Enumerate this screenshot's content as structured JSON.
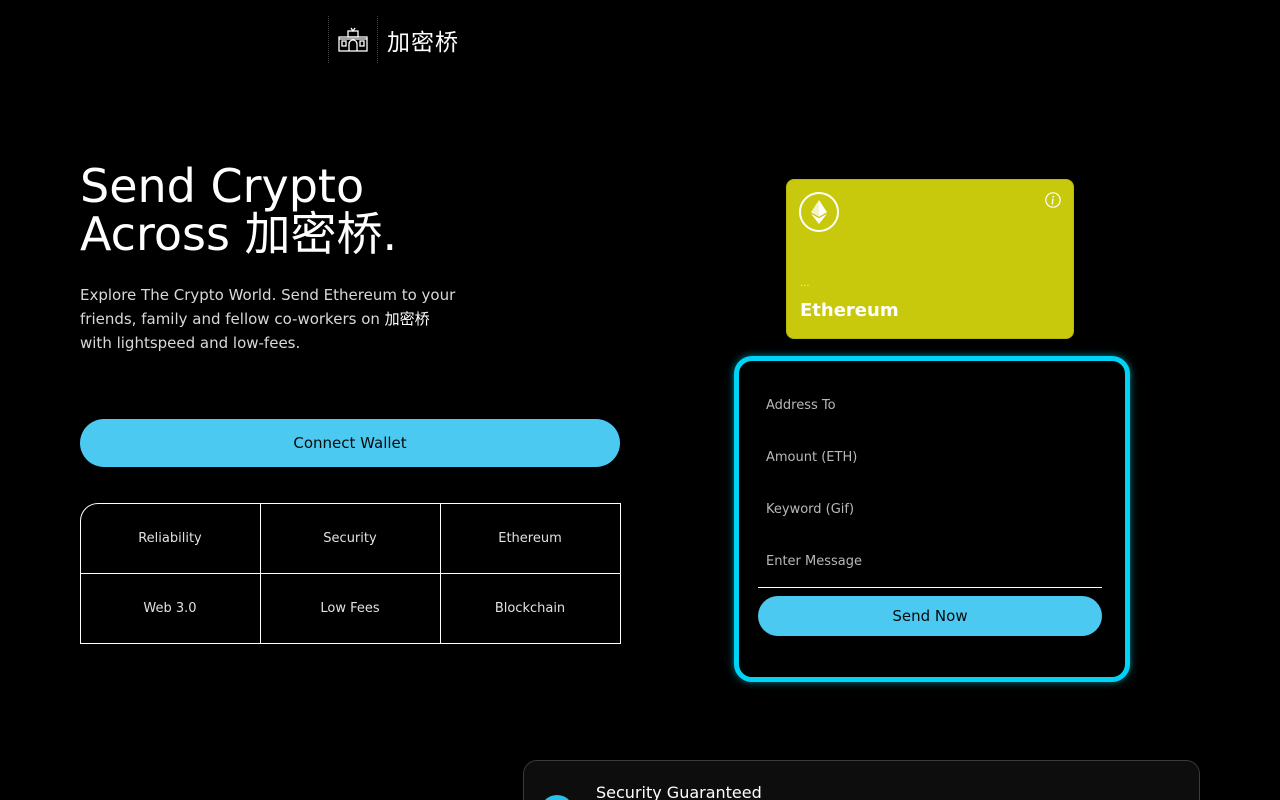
{
  "header": {
    "brand_name": "加密桥",
    "logo_icon": "bridge-gate-icon"
  },
  "hero": {
    "title_line1": "Send Crypto",
    "title_line2": "Across 加密桥.",
    "description_part1": "Explore The Crypto World. Send Ethereum to your friends, family and fellow co-workers on ",
    "description_brand": "加密桥",
    "description_part2": " with lightspeed and low-fees.",
    "connect_label": "Connect Wallet"
  },
  "features": [
    "Reliability",
    "Security",
    "Ethereum",
    "Web 3.0",
    "Low Fees",
    "Blockchain"
  ],
  "eth_card": {
    "address": "...",
    "network": "Ethereum",
    "logo_icon": "ethereum-icon",
    "info_icon": "info-icon",
    "background_color": "#c8c80c"
  },
  "send_form": {
    "address_placeholder": "Address To",
    "amount_placeholder": "Amount (ETH)",
    "keyword_placeholder": "Keyword (Gif)",
    "message_placeholder": "Enter Message",
    "submit_label": "Send Now",
    "border_color": "#00d4f5"
  },
  "services": {
    "first_title": "Security Guaranteed"
  },
  "colors": {
    "accent": "#4cc9f0",
    "background": "#000000"
  }
}
